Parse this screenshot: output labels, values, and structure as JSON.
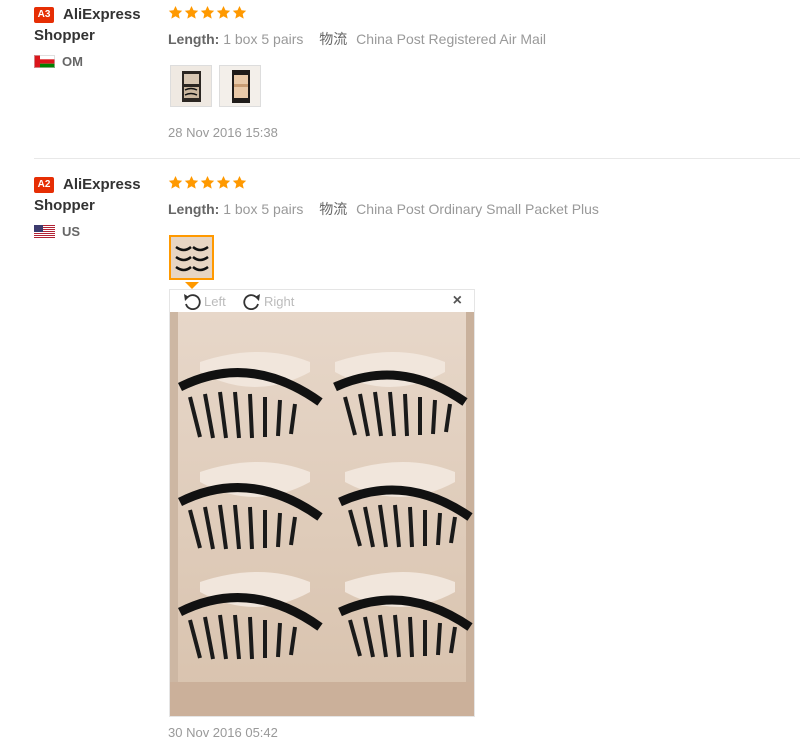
{
  "reviews": [
    {
      "badge": "A3",
      "username": "AliExpress Shopper",
      "country": "OM",
      "rating": 5,
      "length_label": "Length:",
      "length_value": "1 box 5 pairs",
      "shipping_label": "物流",
      "shipping_value": "China Post Registered Air Mail",
      "date": "28 Nov 2016 15:38"
    },
    {
      "badge": "A2",
      "username": "AliExpress Shopper",
      "country": "US",
      "rating": 5,
      "length_label": "Length:",
      "length_value": "1 box 5 pairs",
      "shipping_label": "物流",
      "shipping_value": "China Post Ordinary Small Packet Plus",
      "date": "30 Nov 2016 05:42"
    }
  ],
  "viewer": {
    "rotate_left": "Left",
    "rotate_right": "Right",
    "close": "×"
  },
  "colors": {
    "badge": "#e62e04",
    "star": "#f90",
    "active_thumb": "#f90"
  }
}
